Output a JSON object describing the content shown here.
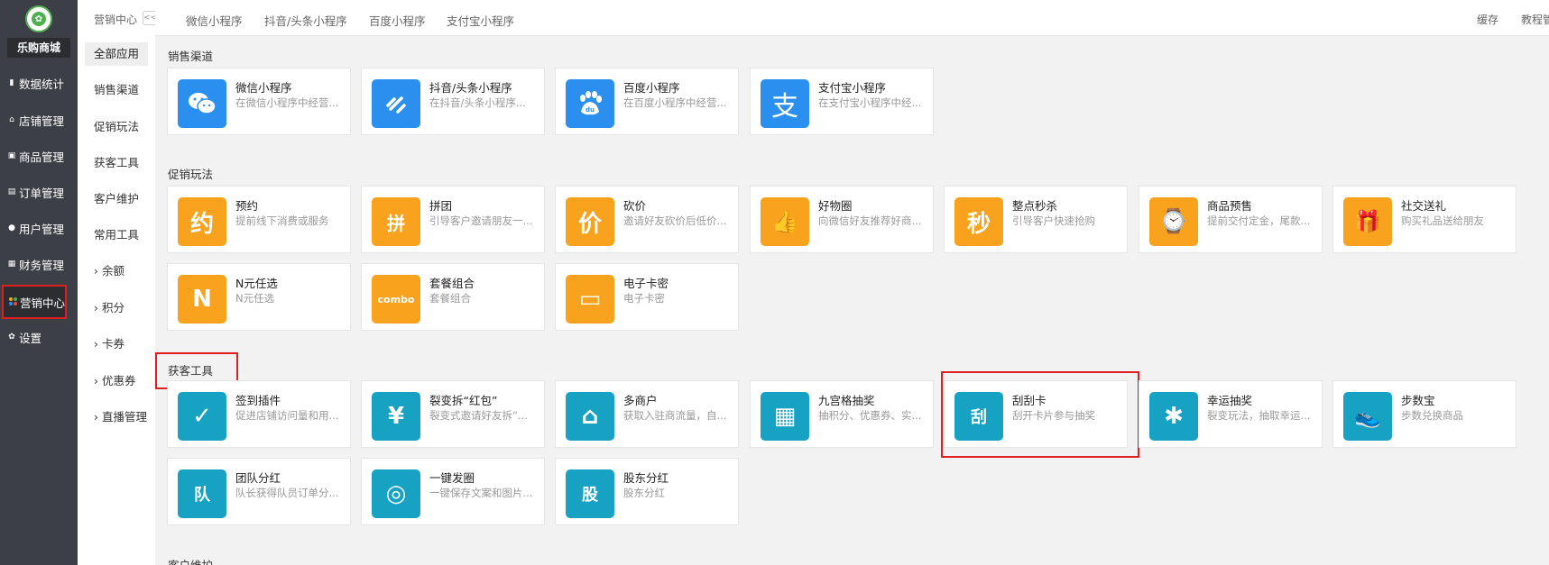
{
  "sidebar": {
    "brand": "乐购商城",
    "items": [
      {
        "label": "数据统计",
        "icon": "chart-icon"
      },
      {
        "label": "店铺管理",
        "icon": "store-icon"
      },
      {
        "label": "商品管理",
        "icon": "goods-icon"
      },
      {
        "label": "订单管理",
        "icon": "order-icon"
      },
      {
        "label": "用户管理",
        "icon": "user-icon"
      },
      {
        "label": "财务管理",
        "icon": "finance-icon"
      },
      {
        "label": "营销中心",
        "icon": "marketing-icon"
      },
      {
        "label": "设置",
        "icon": "settings-icon"
      }
    ]
  },
  "subnav": {
    "title": "营销中心",
    "collapse": "<<",
    "items": [
      "全部应用",
      "销售渠道",
      "促销玩法",
      "获客工具",
      "客户维护",
      "常用工具",
      "余额",
      "积分",
      "卡券",
      "优惠券",
      "直播管理"
    ]
  },
  "topbar": {
    "tabs": [
      "微信小程序",
      "抖音/头条小程序",
      "百度小程序",
      "支付宝小程序"
    ],
    "right": [
      "缓存",
      "教程管"
    ]
  },
  "sections": {
    "sales": "销售渠道",
    "promo": "促销玩法",
    "acquire": "获客工具",
    "maintain": "客户维护"
  },
  "cards": {
    "sales": [
      {
        "name": "微信小程序",
        "desc": "在微信小程序中经营...",
        "icon": "wechat-icon"
      },
      {
        "name": "抖音/头条小程序",
        "desc": "在抖音/头条小程序...",
        "icon": "douyin-icon"
      },
      {
        "name": "百度小程序",
        "desc": "在百度小程序中经营...",
        "icon": "baidu-icon"
      },
      {
        "name": "支付宝小程序",
        "desc": "在支付宝小程序中经...",
        "icon": "alipay-icon"
      }
    ],
    "promo": [
      {
        "name": "预约",
        "desc": "提前线下消费或服务",
        "glyph": "约"
      },
      {
        "name": "拼团",
        "desc": "引导客户邀请朋友一...",
        "glyph": "拼"
      },
      {
        "name": "砍价",
        "desc": "邀请好友砍价后低价...",
        "glyph": "价"
      },
      {
        "name": "好物圈",
        "desc": "向微信好友推荐好商...",
        "glyph": "👍"
      },
      {
        "name": "整点秒杀",
        "desc": "引导客户快速抢购",
        "glyph": "秒"
      },
      {
        "name": "商品预售",
        "desc": "提前交付定金，尾款...",
        "glyph": "⌚"
      },
      {
        "name": "社交送礼",
        "desc": "购买礼品送给朋友",
        "glyph": "🎁"
      },
      {
        "name": "N元任选",
        "desc": "N元任选",
        "glyph": "N"
      },
      {
        "name": "套餐组合",
        "desc": "套餐组合",
        "glyph": "combo"
      },
      {
        "name": "电子卡密",
        "desc": "电子卡密",
        "glyph": "▭"
      }
    ],
    "acquire": [
      {
        "name": "签到插件",
        "desc": "促进店铺访问量和用...",
        "glyph": "✓"
      },
      {
        "name": "裂变拆“红包”",
        "desc": "裂变式邀请好友拆“...",
        "glyph": "¥"
      },
      {
        "name": "多商户",
        "desc": "获取入驻商流量，自...",
        "glyph": "⌂"
      },
      {
        "name": "九宫格抽奖",
        "desc": "抽积分、优惠券、实...",
        "glyph": "▦"
      },
      {
        "name": "刮刮卡",
        "desc": "刮开卡片参与抽奖",
        "glyph": "刮"
      },
      {
        "name": "幸运抽奖",
        "desc": "裂变玩法，抽取幸运...",
        "glyph": "✱"
      },
      {
        "name": "步数宝",
        "desc": "步数兑换商品",
        "glyph": "👟"
      },
      {
        "name": "团队分红",
        "desc": "队长获得队员订单分...",
        "glyph": "队"
      },
      {
        "name": "一键发圈",
        "desc": "一键保存文案和图片...",
        "glyph": "◎"
      },
      {
        "name": "股东分红",
        "desc": "股东分红",
        "glyph": "股"
      }
    ]
  },
  "colors": {
    "sales": "#2b8ff0",
    "promo": "#f8a21e",
    "acquire": "#17a2c4",
    "highlight": "#e02020"
  }
}
